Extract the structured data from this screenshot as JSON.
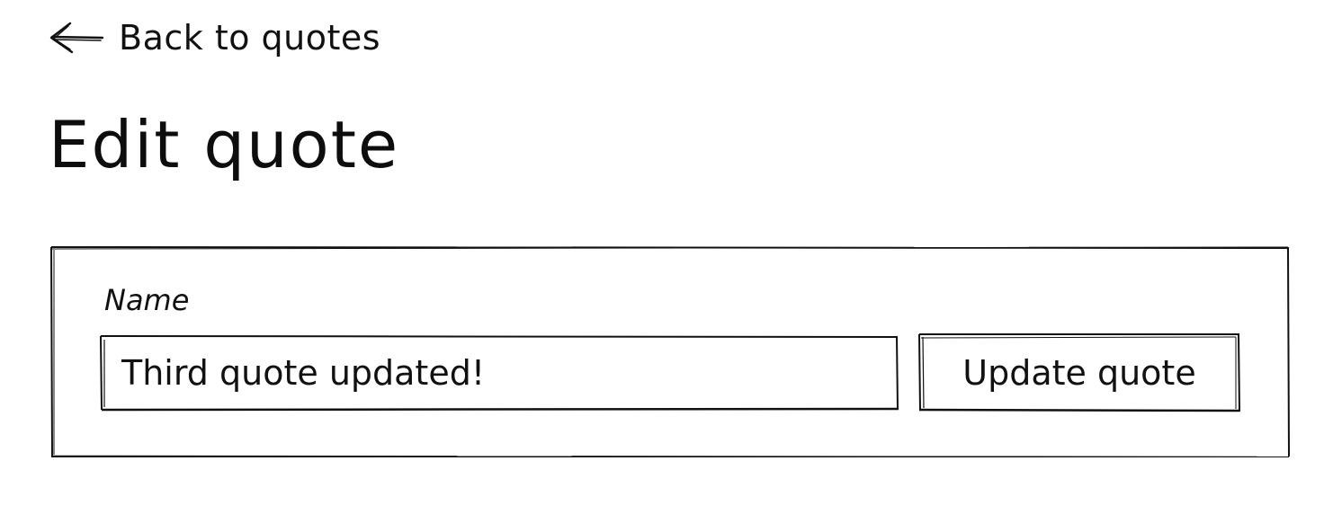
{
  "nav": {
    "back_label": "Back to quotes",
    "back_icon": "arrow-left-icon"
  },
  "page": {
    "title": "Edit quote"
  },
  "form": {
    "name_label": "Name",
    "name_value": "Third quote updated!",
    "submit_label": "Update quote"
  },
  "colors": {
    "ink": "#111111",
    "background": "#ffffff"
  }
}
